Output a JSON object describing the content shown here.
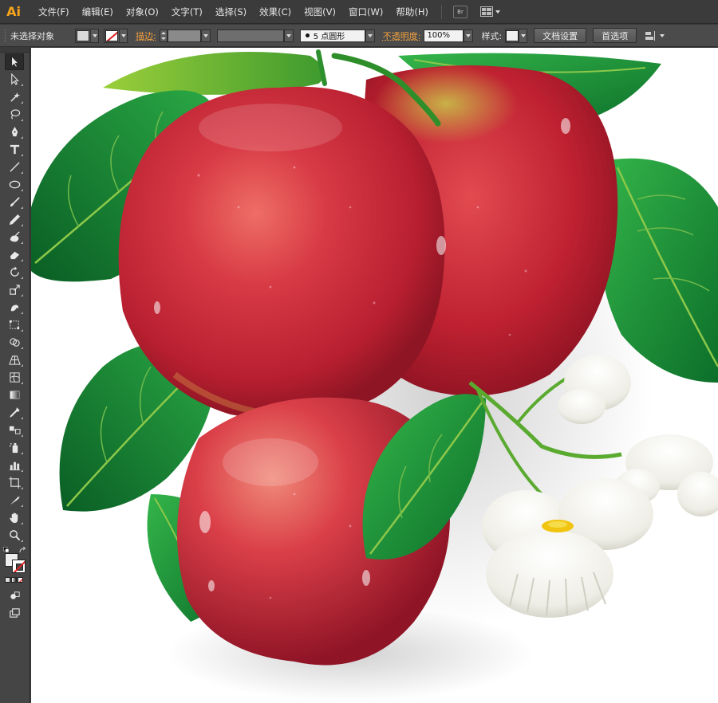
{
  "app": {
    "logo": "Ai"
  },
  "menu": {
    "items": [
      "文件(F)",
      "编辑(E)",
      "对象(O)",
      "文字(T)",
      "选择(S)",
      "效果(C)",
      "视图(V)",
      "窗口(W)",
      "帮助(H)"
    ],
    "bridge_label": "Br"
  },
  "control_bar": {
    "selection_status": "未选择对象",
    "stroke_label": "描边:",
    "brush_value": "5 点圆形",
    "opacity_label": "不透明度:",
    "opacity_value": "100%",
    "style_label": "样式:",
    "doc_setup_button": "文档设置",
    "preferences_button": "首选项"
  },
  "colors": {
    "menubar_bg": "#3b3b3b",
    "controlbar_bg": "#4b4b4b",
    "toolpanel_bg": "#454545",
    "logo": "#f7a51c",
    "label_accent": "#f0a040",
    "apple_red": "#c8202e",
    "leaf_green": "#1f9a3a",
    "flower_white": "#f4f3ee"
  },
  "tools": [
    "selection-tool",
    "direct-selection-tool",
    "magic-wand-tool",
    "lasso-tool",
    "pen-tool",
    "type-tool",
    "line-tool",
    "ellipse-tool",
    "paintbrush-tool",
    "pencil-tool",
    "blob-brush-tool",
    "eraser-tool",
    "rotate-tool",
    "scale-tool",
    "warp-tool",
    "free-transform-tool",
    "shape-builder-tool",
    "perspective-grid-tool",
    "mesh-tool",
    "gradient-tool",
    "eyedropper-tool",
    "blend-tool",
    "symbol-sprayer-tool",
    "column-graph-tool",
    "artboard-tool",
    "slice-tool",
    "hand-tool",
    "zoom-tool"
  ]
}
